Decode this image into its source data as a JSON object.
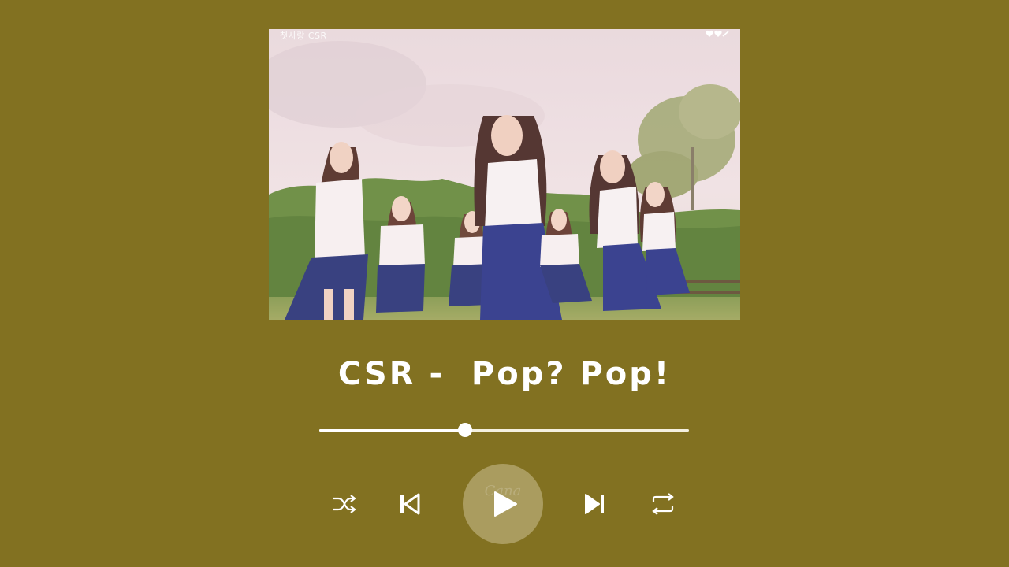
{
  "player": {
    "album_art": {
      "watermark_text": "첫사랑 CSR",
      "corner_logo_icon": "heart-logo-icon",
      "alt": "group-photo"
    },
    "title": "CSR -  Pop? Pop!",
    "progress": {
      "fraction": 0.395
    },
    "controls": {
      "shuffle_icon": "shuffle-icon",
      "previous_icon": "skip-previous-icon",
      "play_icon": "play-icon",
      "play_watermark": "Cana",
      "next_icon": "skip-next-icon",
      "repeat_icon": "repeat-icon"
    },
    "colors": {
      "background": "#827121",
      "foreground": "#ffffff",
      "play_circle": "rgba(236,226,196,0.38)"
    }
  }
}
